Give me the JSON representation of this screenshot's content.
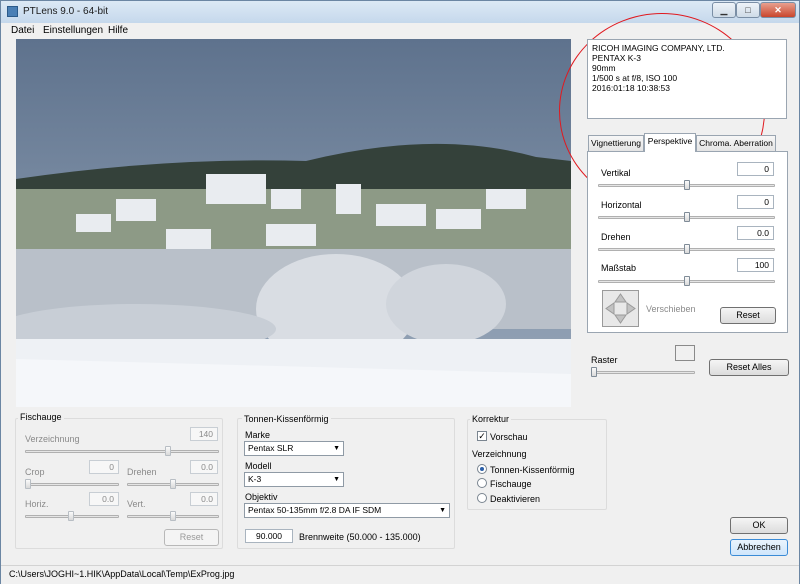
{
  "window": {
    "title": "PTLens 9.0 - 64-bit",
    "btn_min": "▁",
    "btn_max": "□",
    "btn_close": "✕"
  },
  "menu": [
    "Datei",
    "Einstellungen",
    "Hilfe"
  ],
  "exif": {
    "make": "RICOH IMAGING COMPANY, LTD.",
    "model": "PENTAX K-3",
    "focal": "90mm",
    "exposure": "1/500 s at f/8, ISO 100",
    "date": "2016:01:18 10:38:53"
  },
  "tabs": [
    "Vignettierung",
    "Perspektive",
    "Chroma. Aberration"
  ],
  "perspective": {
    "vertikal": {
      "label": "Vertikal",
      "value": "0",
      "level": 0.5
    },
    "horizontal": {
      "label": "Horizontal",
      "value": "0",
      "level": 0.5
    },
    "drehen": {
      "label": "Drehen",
      "value": "0.0",
      "level": 0.5
    },
    "massstab": {
      "label": "Maßstab",
      "value": "100",
      "level": 0.5
    },
    "verschieben": "Verschieben",
    "reset": "Reset"
  },
  "raster": {
    "label": "Raster",
    "reset_all": "Reset Alles"
  },
  "fisheye": {
    "title": "Fischauge",
    "verzeichnung_label": "Verzeichnung",
    "verzeichnung_value": "140",
    "crop_label": "Crop",
    "crop_value": "0",
    "drehen_label": "Drehen",
    "drehen_value": "0.0",
    "horiz_label": "Horiz.",
    "horiz_value": "0.0",
    "vert_label": "Vert.",
    "vert_value": "0.0",
    "reset": "Reset"
  },
  "pincushion": {
    "title": "Tonnen-Kissenförmig",
    "marke_label": "Marke",
    "marke_value": "Pentax SLR",
    "modell_label": "Modell",
    "modell_value": "K-3",
    "objektiv_label": "Objektiv",
    "objektiv_value": "Pentax 50-135mm f/2.8 DA IF SDM",
    "brennweite_value": "90.000",
    "brennweite_label": "Brennweite (50.000 - 135.000)"
  },
  "correction": {
    "title": "Korrektur",
    "vorschau": "Vorschau",
    "verzeichnung_label": "Verzeichnung",
    "options": [
      "Tonnen-Kissenförmig",
      "Fischauge",
      "Deaktivieren"
    ]
  },
  "ok": "OK",
  "cancel": "Abbrechen",
  "status_path": "C:\\Users\\JOGHI~1.HIK\\AppData\\Local\\Temp\\ExProg.jpg",
  "colors": {
    "annotation": "#e0191f",
    "accent": "#3b8bd6"
  }
}
